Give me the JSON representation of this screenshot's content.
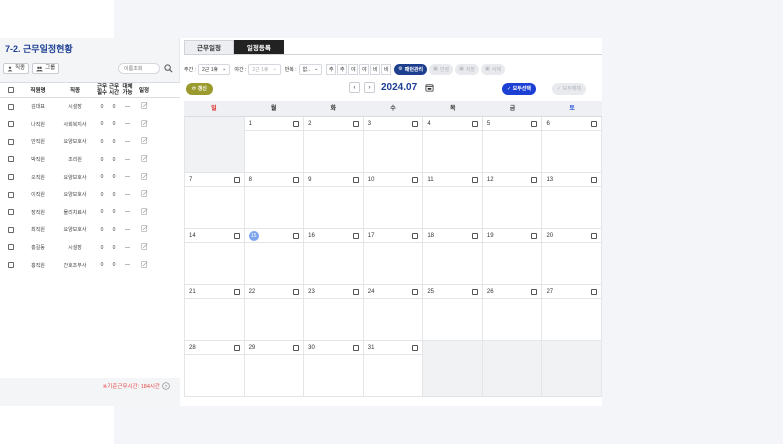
{
  "page_title": "7-2. 근무일정현황",
  "left": {
    "filter_job": "직종",
    "filter_group": "그룹",
    "search_placeholder": "이름조회",
    "headers": {
      "name": "직원명",
      "job": "직종",
      "work_hours": "근무\n필수",
      "work_time": "근무\n시간",
      "substitute": "대체\n가능",
      "schedule": "일정"
    },
    "employees": [
      {
        "name": "김대표",
        "job": "시설장",
        "a": "0",
        "b": "0",
        "c": "—"
      },
      {
        "name": "나직원",
        "job": "사회복지사",
        "a": "0",
        "b": "0",
        "c": "—"
      },
      {
        "name": "안직원",
        "job": "요양보호사",
        "a": "0",
        "b": "0",
        "c": "—"
      },
      {
        "name": "박직원",
        "job": "조리원",
        "a": "0",
        "b": "0",
        "c": "—"
      },
      {
        "name": "오직원",
        "job": "요양보호사",
        "a": "0",
        "b": "0",
        "c": "—"
      },
      {
        "name": "이직원",
        "job": "요양보호사",
        "a": "0",
        "b": "0",
        "c": "—"
      },
      {
        "name": "장직원",
        "job": "물리치료사",
        "a": "0",
        "b": "0",
        "c": "—"
      },
      {
        "name": "최직원",
        "job": "요양보호사",
        "a": "0",
        "b": "0",
        "c": "—"
      },
      {
        "name": "홍길동",
        "job": "시설장",
        "a": "0",
        "b": "0",
        "c": "—"
      },
      {
        "name": "홍직원",
        "job": "간호조무사",
        "a": "0",
        "b": "0",
        "c": "—"
      }
    ],
    "footnote": "※기준근무시간: 184시간"
  },
  "tabs": [
    "근무일정",
    "일정등록"
  ],
  "toolbar": {
    "week_label": "주간 :",
    "week_value": "2근 1휴",
    "night_label": "야간 :",
    "night_value": "2근 1휴",
    "repeat_label": "반복 :",
    "repeat_value": "없..",
    "day_buttons": [
      "주",
      "주",
      "야",
      "야",
      "비",
      "비"
    ],
    "pattern_btn": "패턴관리",
    "apply_btn": "반영",
    "save_btn": "저장",
    "delete_btn": "삭제"
  },
  "calendar": {
    "refresh": "갱신",
    "month": "2024.07",
    "select_all": "모두선택",
    "deselect_all": "모두해제",
    "weekdays": [
      "일",
      "월",
      "화",
      "수",
      "목",
      "금",
      "토"
    ],
    "today": 15,
    "weeks": [
      [
        "",
        "1",
        "2",
        "3",
        "4",
        "5",
        "6"
      ],
      [
        "7",
        "8",
        "9",
        "10",
        "11",
        "12",
        "13"
      ],
      [
        "14",
        "15",
        "16",
        "17",
        "18",
        "19",
        "20"
      ],
      [
        "21",
        "22",
        "23",
        "24",
        "25",
        "26",
        "27"
      ],
      [
        "28",
        "29",
        "30",
        "31",
        "",
        "",
        ""
      ]
    ]
  },
  "colors": {
    "title": "#1c3f94",
    "sunday": "#e02929",
    "saturday": "#2b57d8",
    "today": "#7ea6ee",
    "refresh": "#9a9a2e",
    "select_all": "#1c3fd4"
  }
}
